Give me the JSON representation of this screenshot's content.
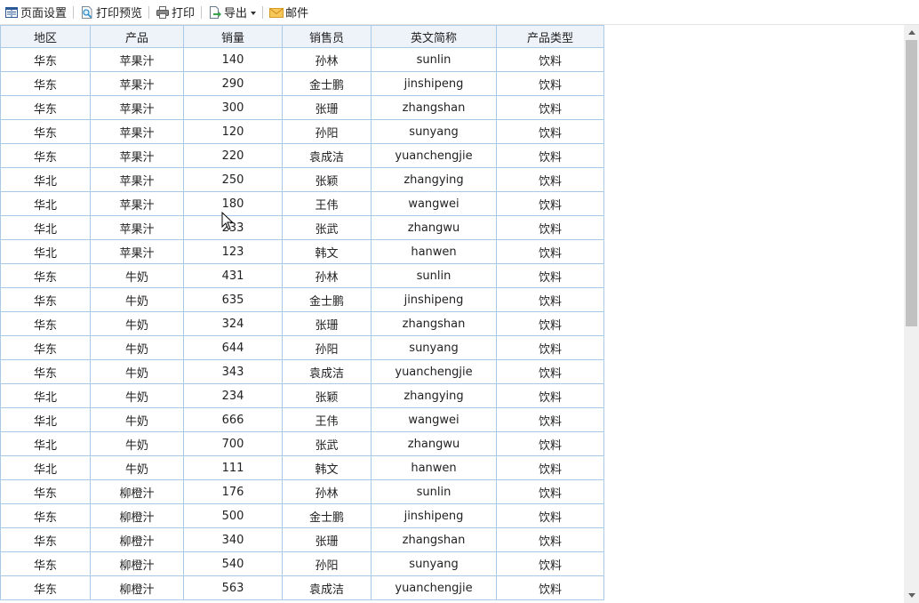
{
  "toolbar": {
    "page_setup": "页面设置",
    "print_preview": "打印预览",
    "print": "打印",
    "export": "导出",
    "mail": "邮件"
  },
  "table": {
    "headers": [
      "地区",
      "产品",
      "销量",
      "销售员",
      "英文简称",
      "产品类型"
    ],
    "rows": [
      [
        "华东",
        "苹果汁",
        "140",
        "孙林",
        "sunlin",
        "饮料"
      ],
      [
        "华东",
        "苹果汁",
        "290",
        "金士鹏",
        "jinshipeng",
        "饮料"
      ],
      [
        "华东",
        "苹果汁",
        "300",
        "张珊",
        "zhangshan",
        "饮料"
      ],
      [
        "华东",
        "苹果汁",
        "120",
        "孙阳",
        "sunyang",
        "饮料"
      ],
      [
        "华东",
        "苹果汁",
        "220",
        "袁成洁",
        "yuanchengjie",
        "饮料"
      ],
      [
        "华北",
        "苹果汁",
        "250",
        "张颖",
        "zhangying",
        "饮料"
      ],
      [
        "华北",
        "苹果汁",
        "180",
        "王伟",
        "wangwei",
        "饮料"
      ],
      [
        "华北",
        "苹果汁",
        "233",
        "张武",
        "zhangwu",
        "饮料"
      ],
      [
        "华北",
        "苹果汁",
        "123",
        "韩文",
        "hanwen",
        "饮料"
      ],
      [
        "华东",
        "牛奶",
        "431",
        "孙林",
        "sunlin",
        "饮料"
      ],
      [
        "华东",
        "牛奶",
        "635",
        "金士鹏",
        "jinshipeng",
        "饮料"
      ],
      [
        "华东",
        "牛奶",
        "324",
        "张珊",
        "zhangshan",
        "饮料"
      ],
      [
        "华东",
        "牛奶",
        "644",
        "孙阳",
        "sunyang",
        "饮料"
      ],
      [
        "华东",
        "牛奶",
        "343",
        "袁成洁",
        "yuanchengjie",
        "饮料"
      ],
      [
        "华北",
        "牛奶",
        "234",
        "张颖",
        "zhangying",
        "饮料"
      ],
      [
        "华北",
        "牛奶",
        "666",
        "王伟",
        "wangwei",
        "饮料"
      ],
      [
        "华北",
        "牛奶",
        "700",
        "张武",
        "zhangwu",
        "饮料"
      ],
      [
        "华北",
        "牛奶",
        "111",
        "韩文",
        "hanwen",
        "饮料"
      ],
      [
        "华东",
        "柳橙汁",
        "176",
        "孙林",
        "sunlin",
        "饮料"
      ],
      [
        "华东",
        "柳橙汁",
        "500",
        "金士鹏",
        "jinshipeng",
        "饮料"
      ],
      [
        "华东",
        "柳橙汁",
        "340",
        "张珊",
        "zhangshan",
        "饮料"
      ],
      [
        "华东",
        "柳橙汁",
        "540",
        "孙阳",
        "sunyang",
        "饮料"
      ],
      [
        "华东",
        "柳橙汁",
        "563",
        "袁成洁",
        "yuanchengjie",
        "饮料"
      ]
    ]
  },
  "colors": {
    "grid_border": "#a9c9e6",
    "header_bg": "#eef3fa"
  },
  "icons": {
    "page_setup": "page-setup-icon",
    "print_preview": "print-preview-icon",
    "print": "printer-icon",
    "export": "export-icon",
    "mail": "mail-icon"
  }
}
